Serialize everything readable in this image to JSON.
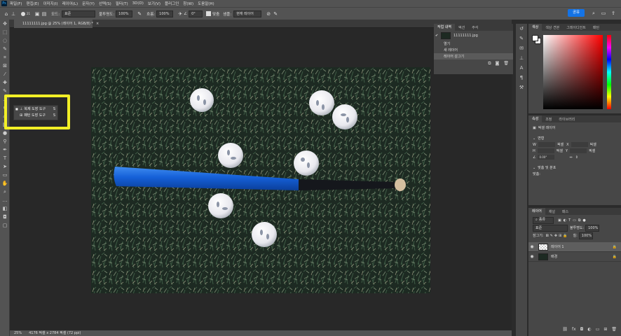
{
  "app": {
    "logo": "Ps"
  },
  "menu": [
    "파일(F)",
    "편집(E)",
    "이미지(I)",
    "레이어(L)",
    "문자(Y)",
    "선택(S)",
    "필터(T)",
    "3D(D)",
    "보기(V)",
    "플러그인",
    "창(W)",
    "도움말(H)"
  ],
  "options": {
    "mode_label": "모드:",
    "mode_value": "표준",
    "opacity_label": "불투명도:",
    "opacity_value": "100%",
    "flow_label": "흐름:",
    "flow_value": "100%",
    "angle_value": "0°",
    "align_label": "맞춤",
    "sample_label": "샘플:",
    "sample_value": "현재 레이어",
    "brush_size": "21",
    "share_label": "공유"
  },
  "document": {
    "tab_title": "11111111.jpg @ 25% (레이어 1, RGB/8) *"
  },
  "tool_flyout": [
    {
      "label": "복제 도장 도구",
      "shortcut": "S"
    },
    {
      "label": "패턴 도장 도구",
      "shortcut": "S"
    }
  ],
  "status": {
    "zoom": "25%",
    "info": "4176 픽셀 x 2784 픽셀 (72 ppi)"
  },
  "history": {
    "tabs": [
      "작업 내역",
      "액션",
      "주석"
    ],
    "snapshot": "11111111.jpg",
    "items": [
      "열기",
      "새 레이어",
      "레이어 감그기"
    ]
  },
  "color": {
    "tabs": [
      "색상",
      "색상 견본",
      "그레이디언트",
      "패턴"
    ]
  },
  "properties": {
    "tabs": [
      "속성",
      "조정",
      "라이브러리"
    ],
    "kind": "픽셀 레이어",
    "transform_label": "변형",
    "w_label": "W",
    "h_label": "H",
    "x_label": "X",
    "y_label": "Y",
    "w_unit": "픽셀",
    "h_unit": "픽셀",
    "x_unit": "픽셀",
    "y_unit": "픽셀",
    "angle": "0.00°",
    "align_label": "맞춤 및 분포",
    "align_sub": "맞춤:"
  },
  "layers": {
    "tabs": [
      "레이어",
      "채널",
      "패스"
    ],
    "filter_label": "종류",
    "blend_mode": "표준",
    "opacity_label": "불투명도:",
    "opacity_value": "100%",
    "lock_label": "잠그기:",
    "fill_label": "칠:",
    "fill_value": "100%",
    "items": [
      {
        "name": "레이어 1"
      },
      {
        "name": "배경"
      }
    ]
  },
  "colors": {
    "highlight": "#f2ef26",
    "accent": "#1473e6",
    "bat": "#1560d8"
  },
  "chart_data": null
}
